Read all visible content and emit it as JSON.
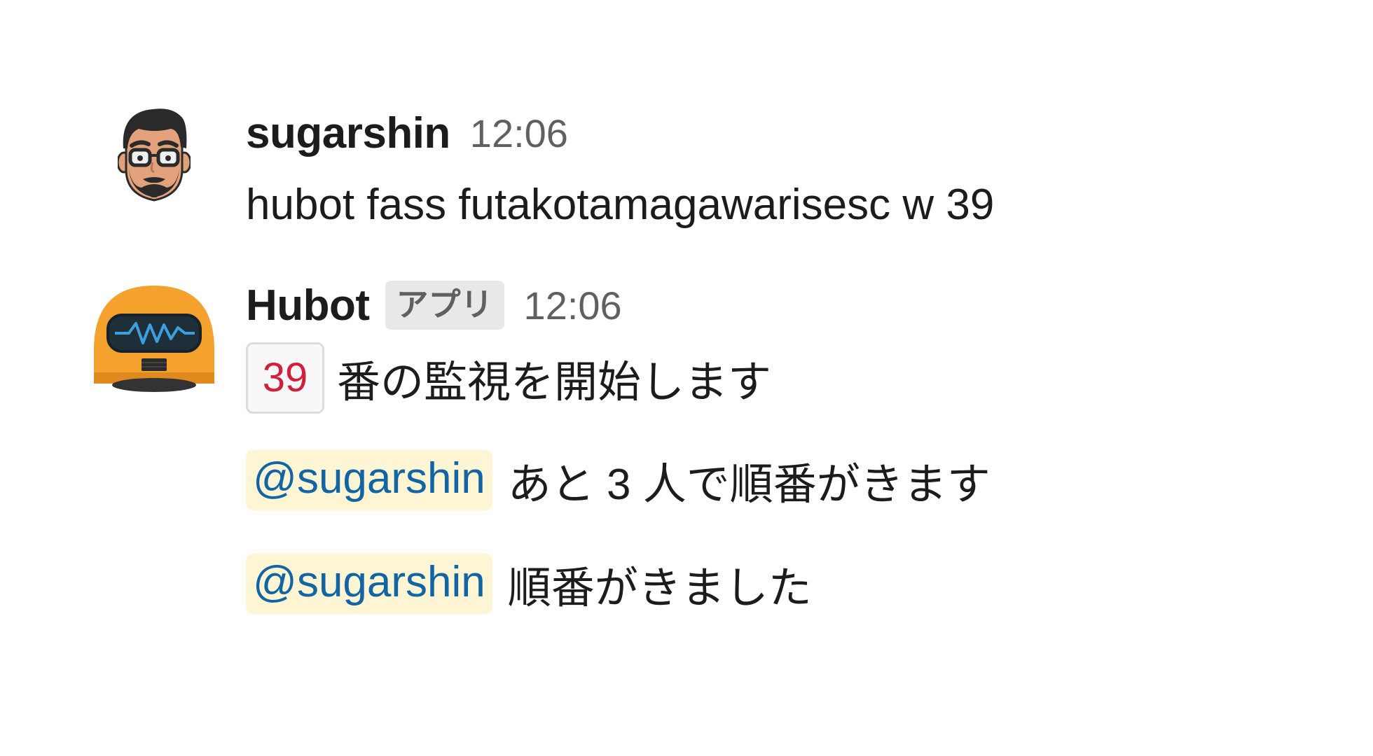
{
  "messages": [
    {
      "author": "sugarshin",
      "time": "12:06",
      "text": "hubot fass futakotamagawarisesc w 39"
    },
    {
      "author": "Hubot",
      "badge": "アプリ",
      "time": "12:06",
      "lines": [
        {
          "number": "39",
          "text": "番の監視を開始します"
        },
        {
          "mention": "@sugarshin",
          "text": "あと 3 人で順番がきます"
        },
        {
          "mention": "@sugarshin",
          "text": "順番がきました"
        }
      ]
    }
  ],
  "colors": {
    "text": "#1d1c1d",
    "muted": "#616061",
    "mention_bg": "#fdf5d4",
    "mention_text": "#1264a3",
    "number_text": "#d0203a",
    "hubot_orange": "#f4a12e"
  },
  "icons": {
    "user_avatar": "bearded-man-avatar",
    "bot_avatar": "hubot-robot-avatar"
  }
}
